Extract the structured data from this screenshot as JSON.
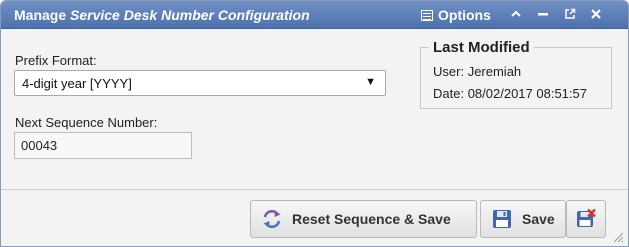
{
  "window": {
    "title_prefix": "Manage",
    "title_italic": "Service Desk Number Configuration",
    "options_label": "Options"
  },
  "form": {
    "prefix_label": "Prefix Format:",
    "prefix_value": "4-digit year [YYYY]",
    "sequence_label": "Next Sequence Number:",
    "sequence_value": "00043"
  },
  "last_modified": {
    "heading": "Last Modified",
    "user_label": "User:",
    "user_value": "Jeremiah",
    "date_label": "Date:",
    "date_value": "08/02/2017 08:51:57"
  },
  "footer": {
    "reset_label": "Reset Sequence & Save",
    "save_label": "Save"
  },
  "icons": {
    "options": "list-icon",
    "collapse": "chevron-up-icon",
    "minimize": "minimize-icon",
    "popout": "popout-icon",
    "close": "close-icon",
    "reset": "refresh-icon",
    "save": "floppy-disk-icon",
    "save_close": "floppy-disk-close-icon"
  },
  "colors": {
    "titlebar": "#4f72ae",
    "window_bg": "#f3f3f3"
  }
}
